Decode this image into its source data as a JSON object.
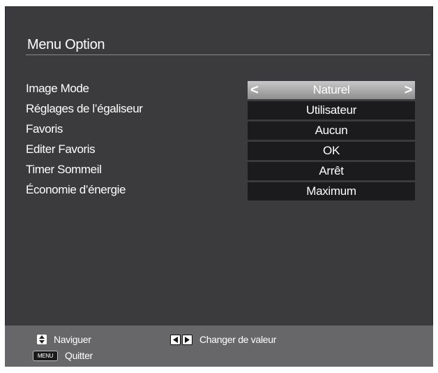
{
  "menu": {
    "title": "Menu Option",
    "items": [
      {
        "label": "Image Mode",
        "value": "Naturel",
        "selected": true
      },
      {
        "label": "Réglages de l’égaliseur",
        "value": "Utilisateur",
        "selected": false
      },
      {
        "label": "Favoris",
        "value": "Aucun",
        "selected": false
      },
      {
        "label": "Editer Favoris",
        "value": "OK",
        "selected": false
      },
      {
        "label": "Timer Sommeil",
        "value": "Arrêt",
        "selected": false
      },
      {
        "label": "Économie d’énergie",
        "value": "Maximum",
        "selected": false
      }
    ],
    "arrow_left": "<",
    "arrow_right": ">"
  },
  "footer": {
    "navigate": "Naviguer",
    "change_value": "Changer de valeur",
    "menu_key": "MENU",
    "quit": "Quitter"
  },
  "colors": {
    "panel_bg": "#3b3b3d",
    "value_bg": "#1b1b1d",
    "selected_bg": "#b0b0b0",
    "footer_bg": "#67676a"
  },
  "icons": {
    "navigate": "up-down-arrows-icon",
    "change_value": "left-right-arrows-icon"
  }
}
